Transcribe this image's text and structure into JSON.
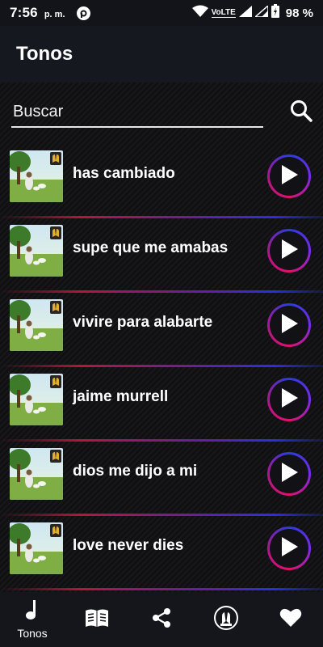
{
  "status_bar": {
    "time": "7:56",
    "ampm": "p. m.",
    "network": "VoLTE",
    "battery": "98 %"
  },
  "app_bar": {
    "title": "Tonos"
  },
  "search": {
    "placeholder": "Buscar",
    "value": ""
  },
  "ringtones": [
    {
      "title": "has cambiado"
    },
    {
      "title": "supe que me amabas"
    },
    {
      "title": "vivire para alabarte"
    },
    {
      "title": "jaime murrell"
    },
    {
      "title": "dios me dijo a mi"
    },
    {
      "title": "love never dies"
    }
  ],
  "bottom_nav": {
    "tonos_label": "Tonos",
    "items": [
      "music-note-icon",
      "book-icon",
      "share-icon",
      "prayer-hands-icon",
      "heart-icon"
    ]
  },
  "colors": {
    "accent_red": "#b8153c",
    "accent_blue": "#2a2fe0",
    "background": "#101013"
  }
}
